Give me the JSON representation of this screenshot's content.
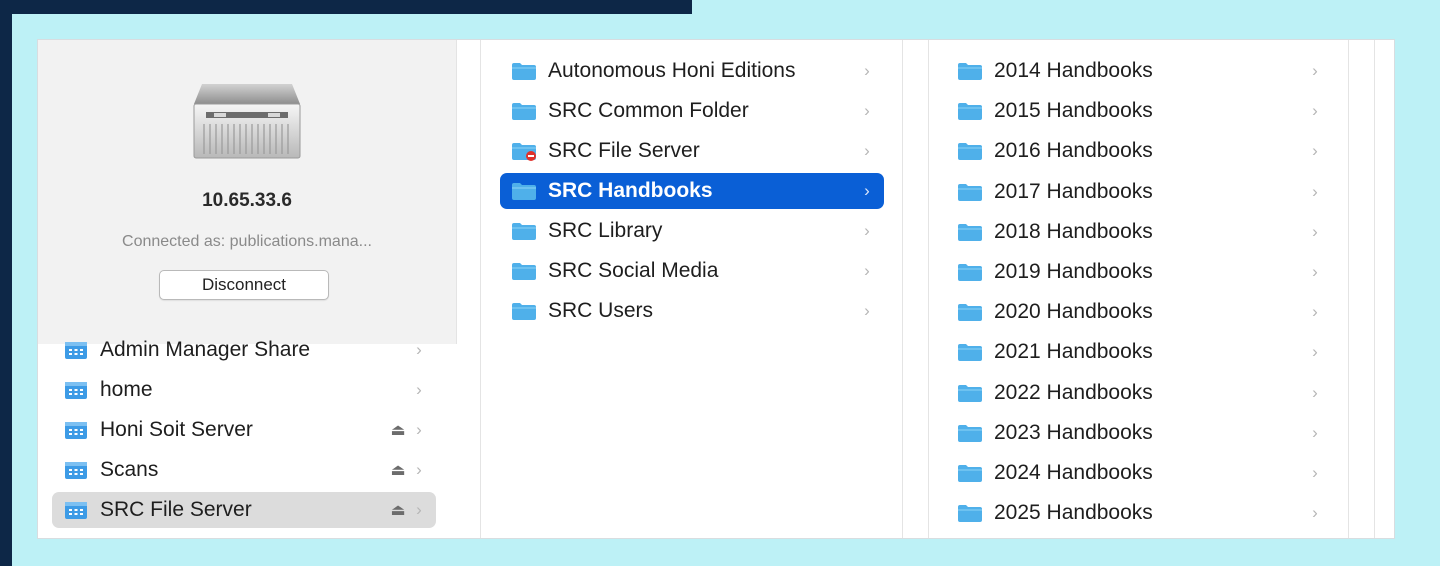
{
  "server": {
    "name": "10.65.33.6",
    "connected_as": "Connected as: publications.mana...",
    "disconnect_label": "Disconnect"
  },
  "shares": [
    {
      "label": "Admin Manager Share",
      "eject": false
    },
    {
      "label": "home",
      "eject": false
    },
    {
      "label": "Honi Soit Server",
      "eject": true
    },
    {
      "label": "Scans",
      "eject": true
    },
    {
      "label": "SRC File Server",
      "eject": true,
      "selected": true
    }
  ],
  "column2": [
    {
      "label": "Autonomous Honi Editions",
      "icon": "folder-icon"
    },
    {
      "label": "SRC Common Folder",
      "icon": "folder-icon"
    },
    {
      "label": "SRC File Server",
      "icon": "folder-no-access-icon"
    },
    {
      "label": "SRC Handbooks",
      "icon": "folder-icon",
      "selected": true
    },
    {
      "label": "SRC Library",
      "icon": "folder-icon"
    },
    {
      "label": "SRC Social Media",
      "icon": "folder-icon"
    },
    {
      "label": "SRC Users",
      "icon": "folder-icon"
    }
  ],
  "column3": [
    {
      "label": "2014 Handbooks"
    },
    {
      "label": "2015 Handbooks"
    },
    {
      "label": "2016 Handbooks"
    },
    {
      "label": "2017 Handbooks"
    },
    {
      "label": "2018 Handbooks"
    },
    {
      "label": "2019 Handbooks"
    },
    {
      "label": "2020 Handbooks"
    },
    {
      "label": "2021 Handbooks"
    },
    {
      "label": "2022 Handbooks"
    },
    {
      "label": "2023 Handbooks"
    },
    {
      "label": "2024 Handbooks"
    },
    {
      "label": "2025 Handbooks"
    }
  ],
  "glyphs": {
    "chevron": "›",
    "eject": "⏏"
  },
  "colors": {
    "selection": "#0a5fd6",
    "folder": "#4fb0ea",
    "folder_tab": "#6ec2f0",
    "no_access": "#e0312b",
    "share_icon": "#3d9be6",
    "background": "#bdf1f6"
  }
}
